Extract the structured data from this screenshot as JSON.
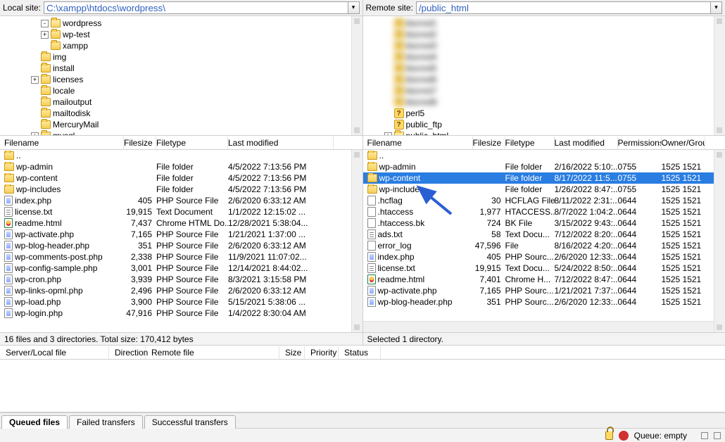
{
  "local": {
    "path_label": "Local site:",
    "path": "C:\\xampp\\htdocs\\wordpress\\",
    "tree": [
      {
        "indent": 4,
        "expander": "-",
        "type": "folder-open",
        "label": "wordpress"
      },
      {
        "indent": 4,
        "expander": "+",
        "type": "folder",
        "label": "wp-test"
      },
      {
        "indent": 4,
        "expander": "",
        "type": "folder",
        "label": "xampp"
      },
      {
        "indent": 3,
        "expander": "",
        "type": "folder",
        "label": "img"
      },
      {
        "indent": 3,
        "expander": "",
        "type": "folder",
        "label": "install"
      },
      {
        "indent": 3,
        "expander": "+",
        "type": "folder",
        "label": "licenses"
      },
      {
        "indent": 3,
        "expander": "",
        "type": "folder",
        "label": "locale"
      },
      {
        "indent": 3,
        "expander": "",
        "type": "folder",
        "label": "mailoutput"
      },
      {
        "indent": 3,
        "expander": "",
        "type": "folder",
        "label": "mailtodisk"
      },
      {
        "indent": 3,
        "expander": "",
        "type": "folder",
        "label": "MercuryMail"
      },
      {
        "indent": 3,
        "expander": "+",
        "type": "folder",
        "label": "mysql"
      }
    ],
    "columns": [
      "Filename",
      "Filesize",
      "Filetype",
      "Last modified"
    ],
    "files": [
      {
        "icon": "up",
        "name": "..",
        "size": "",
        "type": "",
        "modified": ""
      },
      {
        "icon": "folder",
        "name": "wp-admin",
        "size": "",
        "type": "File folder",
        "modified": "4/5/2022 7:13:56 PM"
      },
      {
        "icon": "folder",
        "name": "wp-content",
        "size": "",
        "type": "File folder",
        "modified": "4/5/2022 7:13:56 PM"
      },
      {
        "icon": "folder",
        "name": "wp-includes",
        "size": "",
        "type": "File folder",
        "modified": "4/5/2022 7:13:56 PM"
      },
      {
        "icon": "php",
        "name": "index.php",
        "size": "405",
        "type": "PHP Source File",
        "modified": "2/6/2020 6:33:12 AM"
      },
      {
        "icon": "txt",
        "name": "license.txt",
        "size": "19,915",
        "type": "Text Document",
        "modified": "1/1/2022 12:15:02 ..."
      },
      {
        "icon": "html",
        "name": "readme.html",
        "size": "7,437",
        "type": "Chrome HTML Do...",
        "modified": "12/28/2021 5:38:04..."
      },
      {
        "icon": "php",
        "name": "wp-activate.php",
        "size": "7,165",
        "type": "PHP Source File",
        "modified": "1/21/2021 1:37:00 ..."
      },
      {
        "icon": "php",
        "name": "wp-blog-header.php",
        "size": "351",
        "type": "PHP Source File",
        "modified": "2/6/2020 6:33:12 AM"
      },
      {
        "icon": "php",
        "name": "wp-comments-post.php",
        "size": "2,338",
        "type": "PHP Source File",
        "modified": "11/9/2021 11:07:02..."
      },
      {
        "icon": "php",
        "name": "wp-config-sample.php",
        "size": "3,001",
        "type": "PHP Source File",
        "modified": "12/14/2021 8:44:02..."
      },
      {
        "icon": "php",
        "name": "wp-cron.php",
        "size": "3,939",
        "type": "PHP Source File",
        "modified": "8/3/2021 3:15:58 PM"
      },
      {
        "icon": "php",
        "name": "wp-links-opml.php",
        "size": "2,496",
        "type": "PHP Source File",
        "modified": "2/6/2020 6:33:12 AM"
      },
      {
        "icon": "php",
        "name": "wp-load.php",
        "size": "3,900",
        "type": "PHP Source File",
        "modified": "5/15/2021 5:38:06 ..."
      },
      {
        "icon": "php",
        "name": "wp-login.php",
        "size": "47,916",
        "type": "PHP Source File",
        "modified": "1/4/2022 8:30:04 AM"
      }
    ],
    "status": "16 files and 3 directories. Total size: 170,412 bytes"
  },
  "remote": {
    "path_label": "Remote site:",
    "path": "/public_html",
    "tree": [
      {
        "indent": 2,
        "expander": "",
        "type": "q",
        "label": "blurred1",
        "blur": true
      },
      {
        "indent": 2,
        "expander": "",
        "type": "q",
        "label": "blurred2",
        "blur": true
      },
      {
        "indent": 2,
        "expander": "",
        "type": "q",
        "label": "blurred3",
        "blur": true
      },
      {
        "indent": 2,
        "expander": "",
        "type": "q",
        "label": "blurred4",
        "blur": true
      },
      {
        "indent": 2,
        "expander": "",
        "type": "q",
        "label": "blurred5",
        "blur": true
      },
      {
        "indent": 2,
        "expander": "",
        "type": "q",
        "label": "blurred6",
        "blur": true
      },
      {
        "indent": 2,
        "expander": "",
        "type": "q",
        "label": "blurred7",
        "blur": true
      },
      {
        "indent": 2,
        "expander": "",
        "type": "q",
        "label": "blurred8",
        "blur": true
      },
      {
        "indent": 2,
        "expander": "",
        "type": "q",
        "label": "perl5"
      },
      {
        "indent": 2,
        "expander": "",
        "type": "q",
        "label": "public_ftp"
      },
      {
        "indent": 2,
        "expander": "+",
        "type": "folder-open",
        "label": "public_html"
      }
    ],
    "columns": [
      "Filename",
      "Filesize",
      "Filetype",
      "Last modified",
      "Permissions",
      "Owner/Group"
    ],
    "files": [
      {
        "icon": "up",
        "name": "..",
        "size": "",
        "type": "",
        "modified": "",
        "perm": "",
        "own": ""
      },
      {
        "icon": "folder",
        "name": "wp-admin",
        "size": "",
        "type": "File folder",
        "modified": "2/16/2022 5:10:...",
        "perm": "0755",
        "own": "1525 1521"
      },
      {
        "icon": "folder",
        "name": "wp-content",
        "size": "",
        "type": "File folder",
        "modified": "8/17/2022 11:5...",
        "perm": "0755",
        "own": "1525 1521",
        "selected": true
      },
      {
        "icon": "folder",
        "name": "wp-includes",
        "size": "",
        "type": "File folder",
        "modified": "1/26/2022 8:47:...",
        "perm": "0755",
        "own": "1525 1521"
      },
      {
        "icon": "file",
        "name": ".hcflag",
        "size": "30",
        "type": "HCFLAG File",
        "modified": "8/11/2022 2:31:...",
        "perm": "0644",
        "own": "1525 1521"
      },
      {
        "icon": "file",
        "name": ".htaccess",
        "size": "1,977",
        "type": "HTACCESS...",
        "modified": "8/7/2022 1:04:2...",
        "perm": "0644",
        "own": "1525 1521"
      },
      {
        "icon": "file",
        "name": ".htaccess.bk",
        "size": "724",
        "type": "BK File",
        "modified": "3/15/2022 9:43:...",
        "perm": "0644",
        "own": "1525 1521"
      },
      {
        "icon": "txt",
        "name": "ads.txt",
        "size": "58",
        "type": "Text Docu...",
        "modified": "7/12/2022 8:20:...",
        "perm": "0644",
        "own": "1525 1521"
      },
      {
        "icon": "file",
        "name": "error_log",
        "size": "47,596",
        "type": "File",
        "modified": "8/16/2022 4:20:...",
        "perm": "0644",
        "own": "1525 1521"
      },
      {
        "icon": "php",
        "name": "index.php",
        "size": "405",
        "type": "PHP Sourc...",
        "modified": "2/6/2020 12:33:...",
        "perm": "0644",
        "own": "1525 1521"
      },
      {
        "icon": "txt",
        "name": "license.txt",
        "size": "19,915",
        "type": "Text Docu...",
        "modified": "5/24/2022 8:50:...",
        "perm": "0644",
        "own": "1525 1521"
      },
      {
        "icon": "html",
        "name": "readme.html",
        "size": "7,401",
        "type": "Chrome H...",
        "modified": "7/12/2022 8:47:...",
        "perm": "0644",
        "own": "1525 1521"
      },
      {
        "icon": "php",
        "name": "wp-activate.php",
        "size": "7,165",
        "type": "PHP Sourc...",
        "modified": "1/21/2021 7:37:...",
        "perm": "0644",
        "own": "1525 1521"
      },
      {
        "icon": "php",
        "name": "wp-blog-header.php",
        "size": "351",
        "type": "PHP Sourc...",
        "modified": "2/6/2020 12:33:...",
        "perm": "0644",
        "own": "1525 1521"
      }
    ],
    "status": "Selected 1 directory."
  },
  "queue": {
    "columns": [
      "Server/Local file",
      "Direction",
      "Remote file",
      "Size",
      "Priority",
      "Status"
    ],
    "tabs": [
      "Queued files",
      "Failed transfers",
      "Successful transfers"
    ],
    "active_tab": 0
  },
  "footer": {
    "queue_label": "Queue: empty"
  }
}
